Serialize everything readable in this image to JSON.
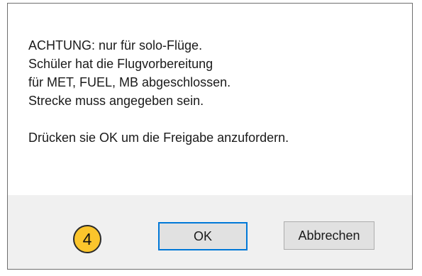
{
  "dialog": {
    "message_lines": [
      "ACHTUNG: nur für solo-Flüge.",
      "Schüler hat die Flugvorbereitung",
      "für MET, FUEL, MB abgeschlossen.",
      "Strecke muss angegeben sein.",
      "Drücken sie OK um die Freigabe anzufordern."
    ],
    "step_badge": "4",
    "ok_label": "OK",
    "cancel_label": "Abbrechen"
  },
  "colors": {
    "background": "#ffffff",
    "button_bar": "#f0f0f0",
    "button_face": "#e1e1e1",
    "default_button_border": "#0078d7",
    "badge_fill": "#fbc52c"
  }
}
